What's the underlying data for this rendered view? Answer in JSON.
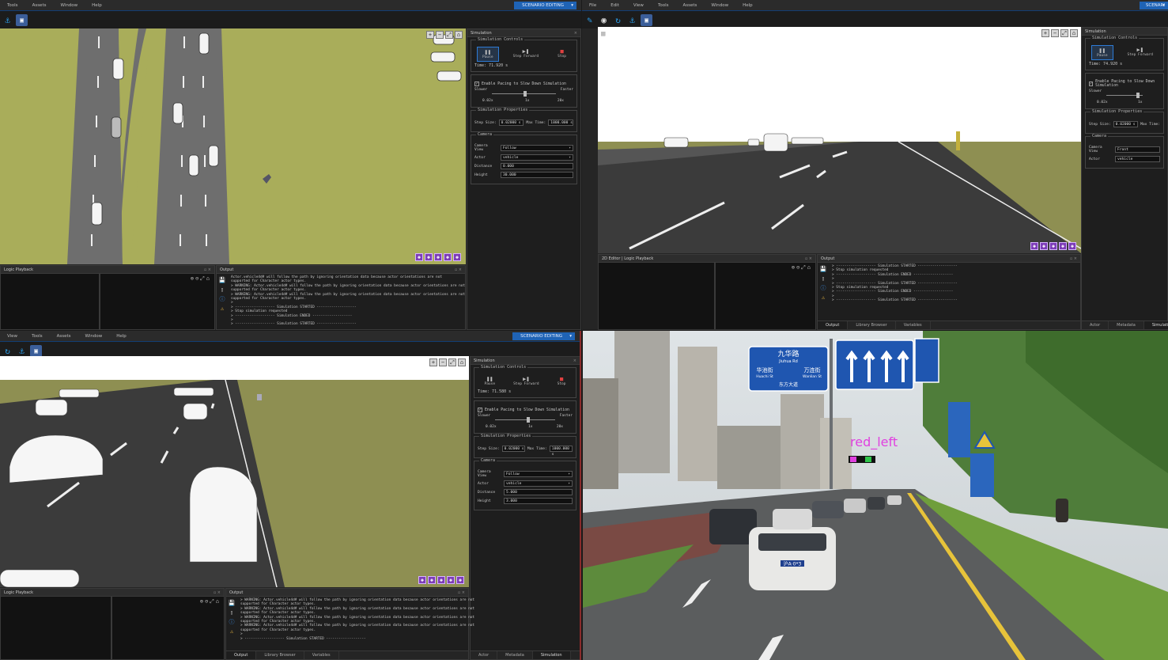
{
  "menus_q1": [
    "Tools",
    "Assets",
    "Window",
    "Help"
  ],
  "menus_q2": [
    "File",
    "Edit",
    "View",
    "Tools",
    "Assets",
    "Window",
    "Help"
  ],
  "menus_q3": [
    "View",
    "Tools",
    "Assets",
    "Window",
    "Help"
  ],
  "mode_label": "SCENARIO EDITING",
  "mode_label_q2": "SCENARI",
  "sim": {
    "header": "Simulation",
    "controls_title": "Simulation Controls",
    "pause": "Pause",
    "step_forward": "Step Forward",
    "stop": "Stop",
    "time_q1": "Time: 71.920 s",
    "time_q2": "Time: 74.920 s",
    "time_q3": "Time: 71.580 s",
    "pacing_label": "Enable Pacing to Slow Down Simulation",
    "slower": "Slower",
    "faster": "Faster",
    "tick_low": "0.02x",
    "tick_mid": "1x",
    "tick_high": "20x",
    "props_title": "Simulation Properties",
    "step_size_label": "Step Size:",
    "step_size": "0.02000 s",
    "max_time_label": "Max Time:",
    "max_time": "1000.000 s",
    "camera_title": "Camera",
    "camera_view_label": "Camera View",
    "camera_view": "Follow",
    "camera_view_q2": "Front",
    "actor_label": "Actor",
    "actor": "vehicle",
    "distance_label": "Distance",
    "distance_q1": "0.000",
    "distance_q3": "5.000",
    "height_label": "Height",
    "height_q1": "30.000",
    "height_q3": "3.000"
  },
  "playback_title": "Logic Playback",
  "playback_title_q2": "2D Editor | Logic Playback",
  "output_title": "Output",
  "output_lines_q1": [
    "Actor.vehicle4d# will follow the path by ignoring orientation data because actor orientations are not",
    "supported for Character actor types.",
    "> WARNING: Actor.vehicle4d# will follow the path by ignoring orientation data because actor orientations are not",
    "supported for Character actor types.",
    "> WARNING: Actor.vehicle4d# will follow the path by ignoring orientation data because actor orientations are not",
    "supported for Character actor types.",
    ">",
    "> ------------------- Simulation STARTED -------------------",
    "> Stop simulation requested",
    "> ------------------- Simulation ENDED -------------------",
    ">",
    "> ------------------- Simulation STARTED -------------------"
  ],
  "output_lines_q2": [
    "> ------------------- Simulation STARTED -------------------",
    "> Stop simulation requested",
    "> ------------------- Simulation ENDED -------------------",
    ">",
    "> ------------------- Simulation STARTED -------------------",
    "> Stop simulation requested",
    "> ------------------- Simulation ENDED -------------------",
    ">",
    "> ------------------- Simulation STARTED -------------------"
  ],
  "output_lines_q3": [
    "> WARNING: Actor.vehicle4d# will follow the path by ignoring orientation data because actor orientations are not",
    "supported for Character actor types.",
    "> WARNING: Actor.vehicle4d# will follow the path by ignoring orientation data because actor orientations are not",
    "supported for Character actor types.",
    "> WARNING: Actor.vehicle4d# will follow the path by ignoring orientation data because actor orientations are not",
    "supported for Character actor types.",
    "> WARNING: Actor.vehicle4d# will follow the path by ignoring orientation data because actor orientations are not",
    "supported for Character actor types.",
    ">",
    "> ------------------- Simulation STARTED -------------------"
  ],
  "bottom_tabs": [
    "Output",
    "Library Browser",
    "Variables"
  ],
  "right_tabs": [
    "Actor",
    "Metadata",
    "Simulation"
  ],
  "sign_text": {
    "road_cn": "九华路",
    "road_pin": "Jiuhua Rd",
    "left_cn": "华池街",
    "left_pin": "Huachi St",
    "right_cn": "万连街",
    "right_pin": "Wanlian St",
    "bottom_cn": "东方大道"
  },
  "detection_label": "red_left",
  "plate_text": "沪A·0*3",
  "colors": {
    "accent": "#1f63b5",
    "warning": "#e0b040",
    "detect": "#e040e0"
  }
}
